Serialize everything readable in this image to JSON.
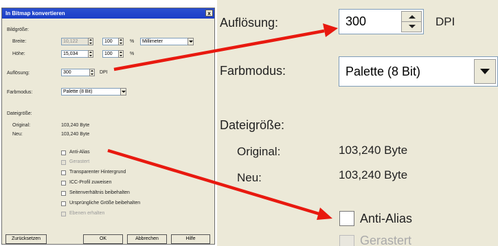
{
  "dialog": {
    "title": "In Bitmap konvertieren",
    "close_symbol": "x",
    "bildgroesse_label": "Bildgröße:",
    "breite_label": "Breite:",
    "breite_value": "10,122",
    "breite_percent": "100",
    "hoehe_label": "Höhe:",
    "hoehe_value": "15,034",
    "hoehe_percent": "100",
    "percent_sign": "%",
    "unit_selected": "Millimeter",
    "aufloesung_label": "Auflösung:",
    "aufloesung_value": "300",
    "dpi_label": "DPI",
    "farbmodus_label": "Farbmodus:",
    "farbmodus_value": "Palette (8 Bit)",
    "dateigroesse_label": "Dateigröße:",
    "original_label": "Original:",
    "original_value": "103,240 Byte",
    "neu_label": "Neu:",
    "neu_value": "103,240 Byte",
    "options": [
      {
        "label": "Anti-Alias",
        "disabled": false
      },
      {
        "label": "Gerastert",
        "disabled": true
      },
      {
        "label": "Transparenter Hintergrund",
        "disabled": false
      },
      {
        "label": "ICC-Profil zuweisen",
        "disabled": false
      },
      {
        "label": "Seitenverhältnis beibehalten",
        "disabled": false
      },
      {
        "label": "Ursprüngliche Größe beibehalten",
        "disabled": false
      },
      {
        "label": "Ebenen erhalten",
        "disabled": true
      }
    ],
    "buttons": {
      "reset": "Zurücksetzen",
      "ok": "OK",
      "cancel": "Abbrechen",
      "help": "Hilfe"
    }
  },
  "zoom": {
    "aufloesung_label": "Auflösung:",
    "aufloesung_value": "300",
    "dpi_label": "DPI",
    "farbmodus_label": "Farbmodus:",
    "farbmodus_value": "Palette (8 Bit)",
    "dateigroesse_label": "Dateigröße:",
    "original_label": "Original:",
    "original_value": "103,240 Byte",
    "neu_label": "Neu:",
    "neu_value": "103,240 Byte",
    "antialias_label": "Anti-Alias",
    "gerastert_label": "Gerastert"
  },
  "colors": {
    "titlebar": "#1b3ec7",
    "dialog_bg": "#ece9d8",
    "arrow": "#e8190f"
  }
}
